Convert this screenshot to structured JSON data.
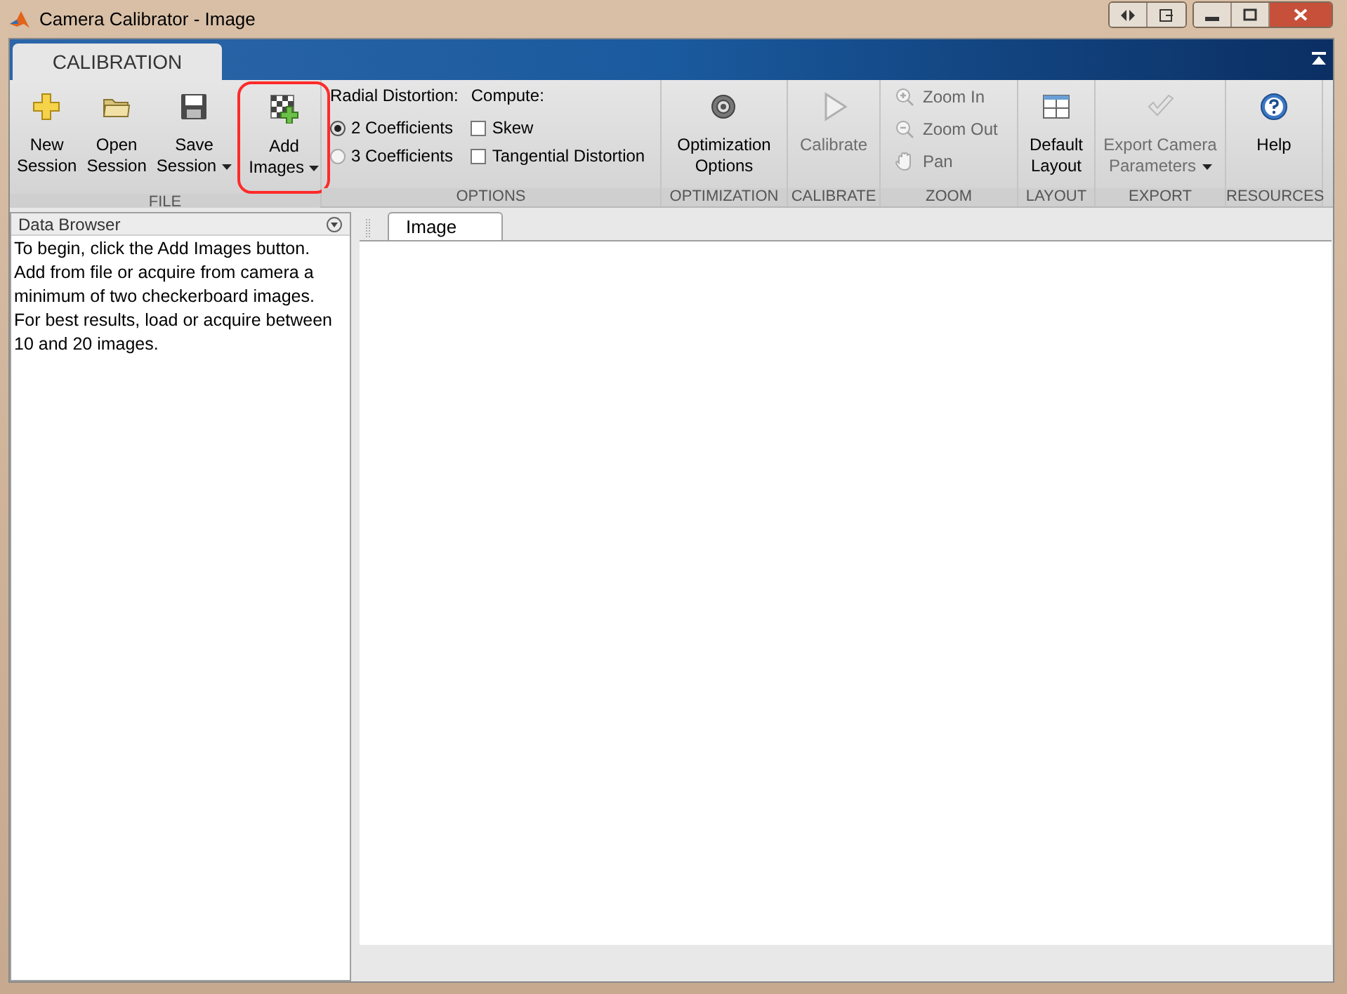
{
  "window": {
    "title": "Camera Calibrator - Image"
  },
  "ribbon_tab": {
    "label": "CALIBRATION",
    "selected": true
  },
  "groups": [
    {
      "label": "FILE",
      "controls": [
        {
          "kind": "large",
          "lines": [
            "New",
            "Session"
          ],
          "dropdown": false,
          "disabled": false,
          "annotated": false
        },
        {
          "kind": "large",
          "lines": [
            "Open",
            "Session"
          ],
          "dropdown": false,
          "disabled": false,
          "annotated": false
        },
        {
          "kind": "large",
          "lines": [
            "Save",
            "Session"
          ],
          "dropdown": true,
          "disabled": false,
          "annotated": false
        },
        {
          "kind": "large",
          "lines": [
            "Add",
            "Images"
          ],
          "dropdown": true,
          "disabled": false,
          "annotated": true
        }
      ]
    },
    {
      "label": "OPTIONS",
      "controls": [
        {
          "kind": "column",
          "heading": "Radial Distortion:",
          "options": [
            {
              "kind": "radio",
              "label": "2 Coefficients",
              "selected": true
            },
            {
              "kind": "radio",
              "label": "3 Coefficients",
              "selected": false
            }
          ]
        },
        {
          "kind": "column",
          "heading": "Compute:",
          "options": [
            {
              "kind": "checkbox",
              "label": "Skew",
              "checked": false
            },
            {
              "kind": "checkbox",
              "label": "Tangential Distortion",
              "checked": false
            }
          ]
        }
      ]
    },
    {
      "label": "OPTIMIZATION",
      "controls": [
        {
          "kind": "large",
          "lines": [
            "Optimization",
            "Options"
          ],
          "dropdown": false,
          "disabled": false,
          "annotated": false
        }
      ]
    },
    {
      "label": "CALIBRATE",
      "controls": [
        {
          "kind": "large",
          "lines": [
            "Calibrate"
          ],
          "dropdown": false,
          "disabled": true,
          "annotated": false
        }
      ]
    },
    {
      "label": "ZOOM",
      "controls": [
        {
          "kind": "small",
          "label": "Zoom In",
          "disabled": true
        },
        {
          "kind": "small",
          "label": "Zoom Out",
          "disabled": true
        },
        {
          "kind": "small",
          "label": "Pan",
          "disabled": true
        }
      ]
    },
    {
      "label": "LAYOUT",
      "controls": [
        {
          "kind": "large",
          "lines": [
            "Default",
            "Layout"
          ],
          "dropdown": false,
          "disabled": false,
          "annotated": false
        }
      ]
    },
    {
      "label": "EXPORT",
      "controls": [
        {
          "kind": "large",
          "lines": [
            "Export Camera",
            "Parameters"
          ],
          "dropdown": true,
          "disabled": true,
          "annotated": false
        }
      ]
    },
    {
      "label": "RESOURCES",
      "controls": [
        {
          "kind": "large",
          "lines": [
            "Help"
          ],
          "dropdown": false,
          "disabled": false,
          "annotated": false
        }
      ]
    }
  ],
  "data_browser": {
    "title": "Data Browser",
    "text": "To begin, click the Add Images button. Add from file or acquire from camera a minimum of two checkerboard images. For best results, load or acquire between 10 and 20 images."
  },
  "document_tabs": [
    {
      "label": "Image",
      "selected": true
    }
  ]
}
